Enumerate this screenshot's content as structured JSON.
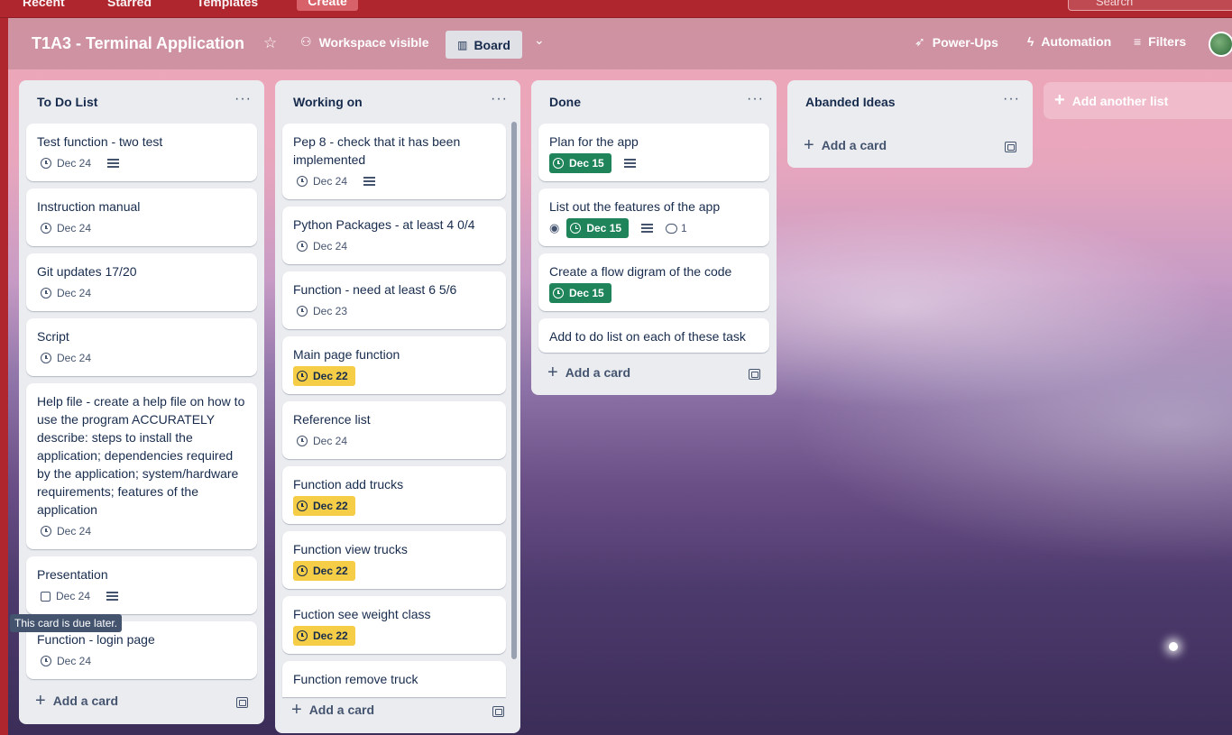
{
  "nav": {
    "recent": "Recent",
    "starred": "Starred",
    "templates": "Templates",
    "create": "Create",
    "search_placeholder": "Search"
  },
  "board": {
    "title": "T1A3 - Terminal Application",
    "visibility": "Workspace visible",
    "view": "Board",
    "power_ups": "Power-Ups",
    "automation": "Automation",
    "filters": "Filters"
  },
  "lists": [
    {
      "title": "To Do List",
      "add_card": "Add a card",
      "cards": [
        {
          "title": "Test function - two test",
          "date": "Dec 24"
        },
        {
          "title": "Instruction manual",
          "date": "Dec 24"
        },
        {
          "title": "Git updates 17/20",
          "date": "Dec 24"
        },
        {
          "title": "Script",
          "date": "Dec 24"
        },
        {
          "title": "Help file - create a help file on how to use the program ACCURATELY describe: steps to install the application; dependencies required by the application; system/hardware requirements; features of the application",
          "date": "Dec 24"
        },
        {
          "title": "Presentation",
          "date": "Dec 24"
        },
        {
          "title": "Function - login page",
          "date": "Dec 24"
        }
      ]
    },
    {
      "title": "Working on",
      "add_card": "Add a card",
      "cards": [
        {
          "title": "Pep 8 - check that it has been implemented",
          "date": "Dec 24"
        },
        {
          "title": "Python Packages - at least 4 0/4",
          "date": "Dec 24"
        },
        {
          "title": "Function - need at least 6 5/6",
          "date": "Dec 23"
        },
        {
          "title": "Main page function",
          "date": "Dec 22"
        },
        {
          "title": "Reference list",
          "date": "Dec 24"
        },
        {
          "title": "Function add trucks",
          "date": "Dec 22"
        },
        {
          "title": "Function view trucks",
          "date": "Dec 22"
        },
        {
          "title": "Fuction see weight class",
          "date": "Dec 22"
        },
        {
          "title": "Function remove truck"
        }
      ]
    },
    {
      "title": "Done",
      "add_card": "Add a card",
      "cards": [
        {
          "title": "Plan for the app",
          "date": "Dec 15"
        },
        {
          "title": "List out the features of the app",
          "date": "Dec 15",
          "comments": "1"
        },
        {
          "title": "Create a flow digram of the code",
          "date": "Dec 15"
        },
        {
          "title": "Add to do list on each of these task"
        }
      ]
    },
    {
      "title": "Abanded Ideas",
      "add_card": "Add a card",
      "cards": []
    }
  ],
  "add_list": "Add another list",
  "tooltip": "This card is due later.",
  "colors": {
    "nav": "#b0262f",
    "due_complete": "#1f845a",
    "due_soon": "#f5cd47",
    "list_bg": "#ebecf0"
  }
}
